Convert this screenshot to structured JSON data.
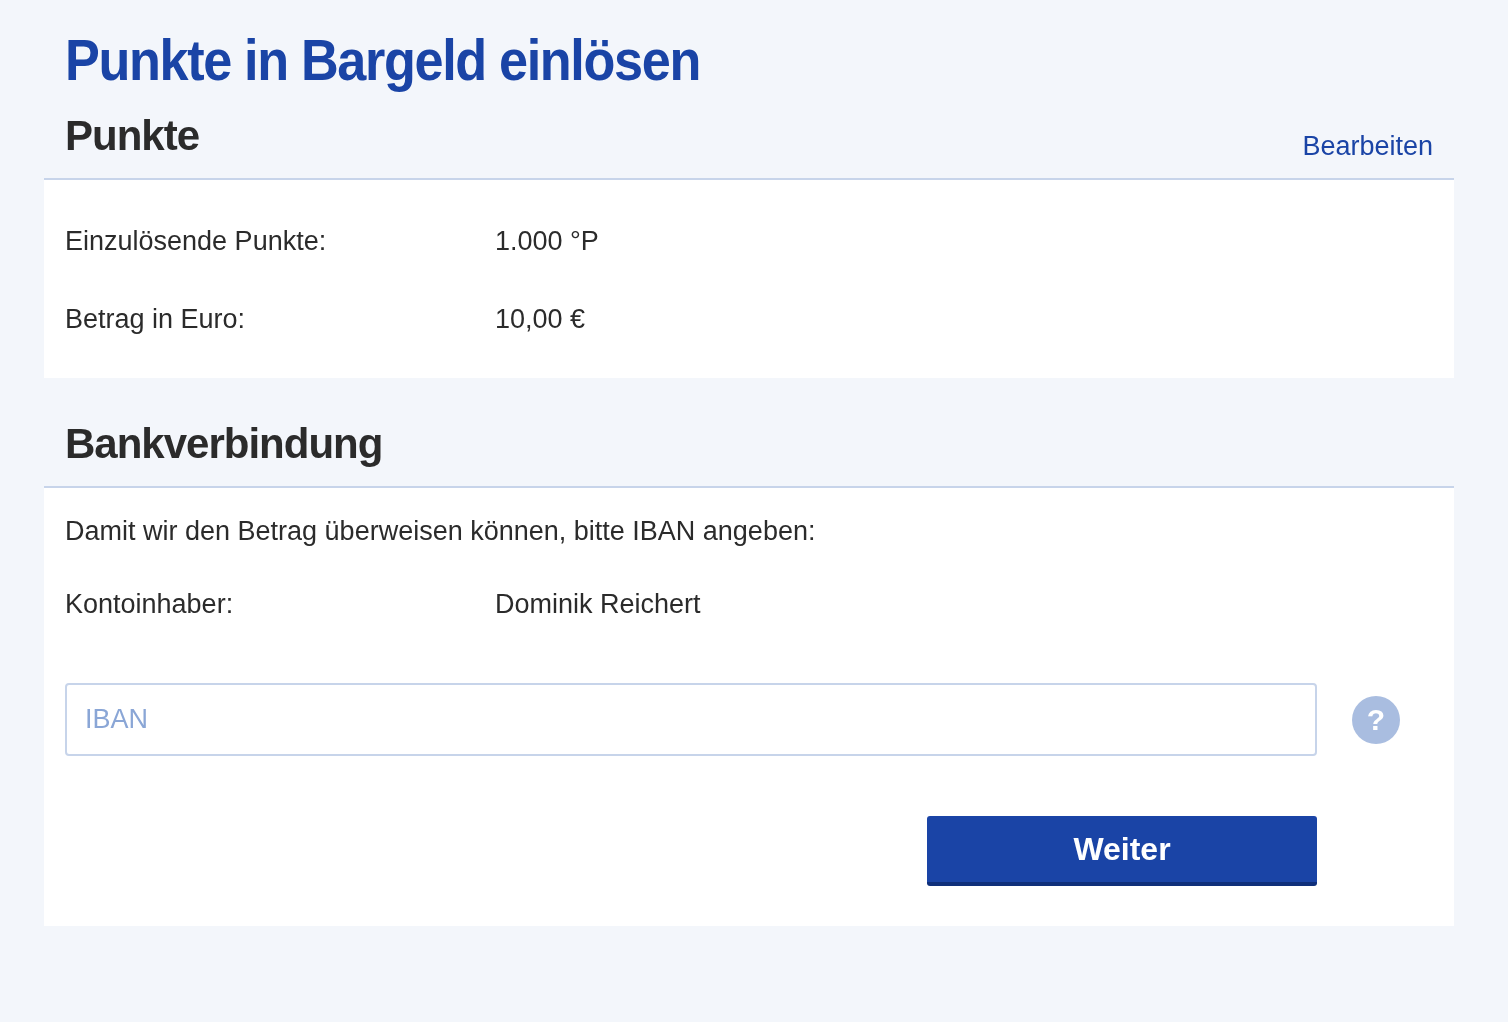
{
  "title": "Punkte in Bargeld einlösen",
  "points_section": {
    "heading": "Punkte",
    "edit_link": "Bearbeiten",
    "rows": [
      {
        "label": "Einzulösende Punkte:",
        "value": "1.000 °P"
      },
      {
        "label": "Betrag in Euro:",
        "value": "10,00 €"
      }
    ]
  },
  "bank_section": {
    "heading": "Bankverbindung",
    "intro": "Damit wir den Betrag überweisen können, bitte IBAN angeben:",
    "rows": [
      {
        "label": "Kontoinhaber:",
        "value": "Dominik Reichert"
      }
    ],
    "iban_field": {
      "placeholder": "IBAN"
    },
    "help_icon": "?",
    "button": "Weiter"
  }
}
